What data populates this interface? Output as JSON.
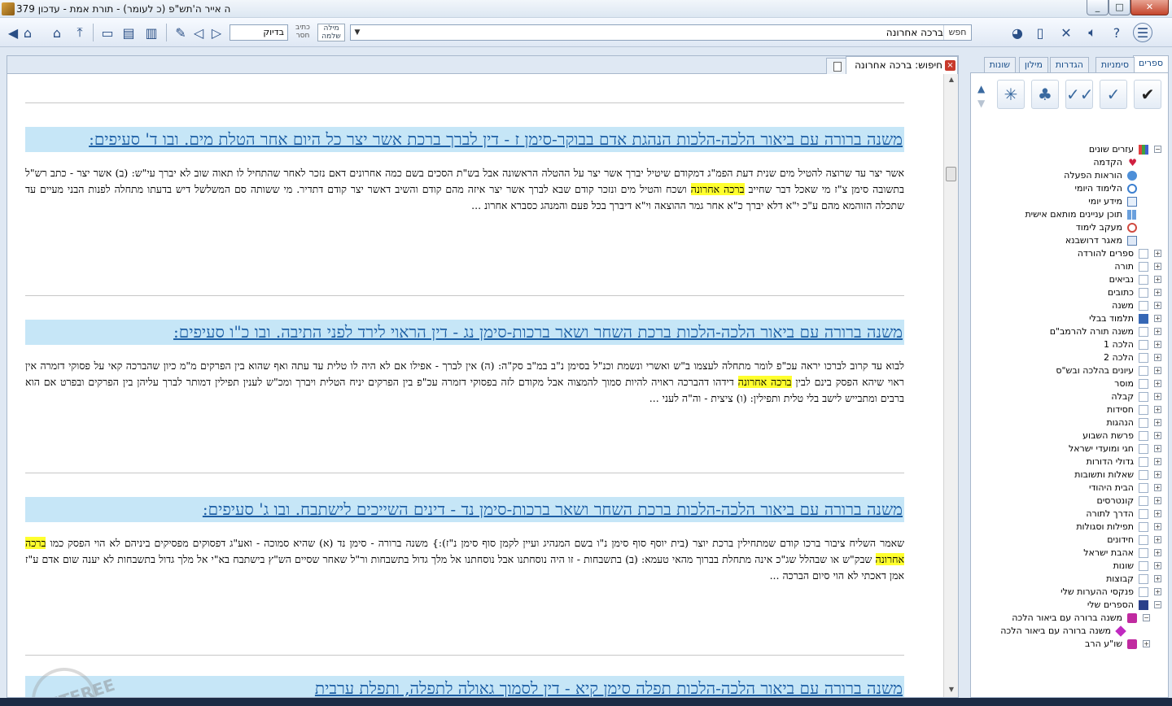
{
  "window": {
    "title": "ה אייר ה'תש\"פ (כ לעומר) - תורת אמת - עדכון 379",
    "min": "0",
    "max": "1",
    "close": "r"
  },
  "toolbar": {
    "search_value": "ברכה אחרונה",
    "search_button": "חפש",
    "check_input_value": "בדיוק",
    "opt_whole_word": "מילה שלמה",
    "opt_missing": "כתיב חסר",
    "help_label": "?"
  },
  "tab": {
    "label": "חיפוש: ברכה אחרונה",
    "close": "×"
  },
  "results": [
    {
      "title": "משנה ברורה עם ביאור הלכה-הלכות הנהגת אדם בבוקר-סימן ז - דין לברך ברכת אשר יצר כל היום אחר הטלת מים. ובו ד' סעיפים:",
      "text_before": "אשר יצר עד שרוצה להטיל מים שנית דעת הפמ\"ג דמקודם שיטיל יברך אשר יצר על ההטלה הראשונה אבל בש\"ת הסכים בשם כמה אחרונים דאם נזכר לאחר שהתחיל לו תאוה שוב לא יברך עי\"ש: (ב) אשר יצר - כתב רש\"ל בתשובה סימן צ\"ז מי שאכל דבר שחייב ",
      "highlight": "ברכה אחרונה",
      "text_after": " ושכח והטיל מים ונזכר קודם שבא לברך אשר יצר איזה מהם קודם והשיב דאשר יצר קודם דתדיר. מי ששותה סם המשלשל דיש בדעתו מתחלה לפנות הבני מעיים עד שתכלה הזוהמא מהם ע\"כ י\"א דלא יברך כ\"א אחר גמר ההוצאה וי\"א דיברך בכל פעם והמנהג כסברא אחרונ ..."
    },
    {
      "title": "משנה ברורה עם ביאור הלכה-הלכות ברכת השחר ושאר ברכות-סימן נג - דין הראוי לירד לפני התיבה. ובו כ\"ו סעיפים:",
      "text_before": "לבוא עד קרוב לברכו יראה עכ\"פ לומר מתחלה לעצמו ב\"ש ואשרי ונשמת וכנ\"ל בסימן נ\"ב במ\"ב סק\"ה: (ה) אין לברך - אפילו אם לא היה לו טלית עד עתה ואף שהוא בין הפרקים מ\"מ כיון שהברכה קאי על פסוקי דזמרה אין ראוי שיהא הפסק בינם לבין ",
      "highlight": "ברכה אחרונה",
      "text_after": " דידהו דהברכה ראויה להיות סמוך להמצוה אבל מקודם לזה בפסוקי דזמרה עכ\"פ בין הפרקים יניח הטלית ויברך ומכ\"ש לענין תפילין דמותר לברך עליהן בין הפרקים ובפרט אם הוא ברבים ומתבייש לישב בלי טלית ותפילין: (ו) ציצית - וה\"ה לעני ..."
    },
    {
      "title": "משנה ברורה עם ביאור הלכה-הלכות ברכת השחר ושאר ברכות-סימן נד - דינים השייכים לישתבח. ובו ג' סעיפים:",
      "text_before": "שאמר השליח ציבור ברכו קודם שמתחילין ברכת יוצר (בית יוסף סוף סימן נ\"ו בשם המנהיג ועיין לקמן סוף סימן נ\"ז):} משנה ברורה - סימן נד (א) שהיא סמוכה - ואע\"ג דפסוקים מפסיקים ביניהם לא הוי הפסק כמו ",
      "highlight": "ברכה אחרונה",
      "text_after": " שבק\"ש או שבהלל שג\"כ אינה מתחלת בברוך מהאי טעמא: (ב) בתשבחות - זו היה נוסחתנו אבל נוסחתנו אל מלך גדול בתשבחות ור\"ל שאחר שסיים הש\"ץ בישתבח בא\"י אל מלך גדול בתשבחות לא יענה שום אדם ע\"ז אמן דאכתי לא הוי סיום הברכה ..."
    },
    {
      "title": "משנה ברורה עם ביאור הלכה-הלכות תפלה סימן קיא - דין לסמוך גאולה לתפלה, ותפלת ערבית"
    }
  ],
  "rpanel": {
    "tabs": [
      "ספרים",
      "סימניות",
      "הגדרות",
      "מילון",
      "שונות"
    ],
    "tree": [
      {
        "label": "עזרים שונים",
        "icon": "multi",
        "exp": "−",
        "indent": 0
      },
      {
        "label": "הקדמה",
        "icon": "heart",
        "exp": "",
        "indent": 1
      },
      {
        "label": "הוראות הפעלה",
        "icon": "q",
        "exp": "",
        "indent": 1
      },
      {
        "label": "הלימוד היומי",
        "icon": "clock",
        "exp": "",
        "indent": 1
      },
      {
        "label": "מידע יומי",
        "icon": "cal",
        "exp": "",
        "indent": 1
      },
      {
        "label": "תוכן עניינים מותאם אישית",
        "icon": "grid",
        "exp": "",
        "indent": 1
      },
      {
        "label": "מעקב לימוד",
        "icon": "redc",
        "exp": "",
        "indent": 1
      },
      {
        "label": "מאגר דרושבנא",
        "icon": "doc",
        "exp": "",
        "indent": 1
      },
      {
        "label": "ספרים להורדה",
        "icon": "folder",
        "exp": "+",
        "indent": 0
      },
      {
        "label": "תורה",
        "icon": "folder",
        "exp": "+",
        "indent": 0
      },
      {
        "label": "נביאים",
        "icon": "folder",
        "exp": "+",
        "indent": 0
      },
      {
        "label": "כתובים",
        "icon": "folder",
        "exp": "+",
        "indent": 0
      },
      {
        "label": "משנה",
        "icon": "folder",
        "exp": "+",
        "indent": 0
      },
      {
        "label": "תלמוד בבלי",
        "icon": "blue",
        "exp": "+",
        "indent": 0
      },
      {
        "label": "משנה תורה להרמב\"ם",
        "icon": "folder",
        "exp": "+",
        "indent": 0
      },
      {
        "label": "הלכה 1",
        "icon": "folder",
        "exp": "+",
        "indent": 0
      },
      {
        "label": "הלכה 2",
        "icon": "folder",
        "exp": "+",
        "indent": 0
      },
      {
        "label": "עיונים בהלכה ובש\"ס",
        "icon": "folder",
        "exp": "+",
        "indent": 0
      },
      {
        "label": "מוסר",
        "icon": "folder",
        "exp": "+",
        "indent": 0
      },
      {
        "label": "קבלה",
        "icon": "folder",
        "exp": "+",
        "indent": 0
      },
      {
        "label": "חסידות",
        "icon": "folder",
        "exp": "+",
        "indent": 0
      },
      {
        "label": "הנהגות",
        "icon": "folder",
        "exp": "+",
        "indent": 0
      },
      {
        "label": "פרשת השבוע",
        "icon": "folder",
        "exp": "+",
        "indent": 0
      },
      {
        "label": "חגי ומועדי ישראל",
        "icon": "folder",
        "exp": "+",
        "indent": 0
      },
      {
        "label": "גדולי הדורות",
        "icon": "folder",
        "exp": "+",
        "indent": 0
      },
      {
        "label": "שאלות ותשובות",
        "icon": "folder",
        "exp": "+",
        "indent": 0
      },
      {
        "label": "הבית היהודי",
        "icon": "folder",
        "exp": "+",
        "indent": 0
      },
      {
        "label": "קונטרסים",
        "icon": "folder",
        "exp": "+",
        "indent": 0
      },
      {
        "label": "הדרך לתורה",
        "icon": "folder",
        "exp": "+",
        "indent": 0
      },
      {
        "label": "תפילות וסגולות",
        "icon": "folder",
        "exp": "+",
        "indent": 0
      },
      {
        "label": "חידונים",
        "icon": "folder",
        "exp": "+",
        "indent": 0
      },
      {
        "label": "אהבת ישראל",
        "icon": "folder",
        "exp": "+",
        "indent": 0
      },
      {
        "label": "שונות",
        "icon": "folder",
        "exp": "+",
        "indent": 0
      },
      {
        "label": "קבוצות",
        "icon": "folder",
        "exp": "+",
        "indent": 0
      },
      {
        "label": "פנקסי ההערות שלי",
        "icon": "folder",
        "exp": "+",
        "indent": 0
      },
      {
        "label": "הספרים שלי",
        "icon": "navy",
        "exp": "−",
        "indent": 0
      },
      {
        "label": "משנה ברורה עם ביאור הלכה",
        "icon": "purple",
        "exp": "−",
        "indent": 1
      },
      {
        "label": "משנה ברורה עם ביאור הלכה",
        "icon": "diamond",
        "exp": "",
        "indent": 2
      },
      {
        "label": "שו\"ע הרב",
        "icon": "purple",
        "exp": "+",
        "indent": 1
      }
    ]
  },
  "watermark": "NETFREE"
}
